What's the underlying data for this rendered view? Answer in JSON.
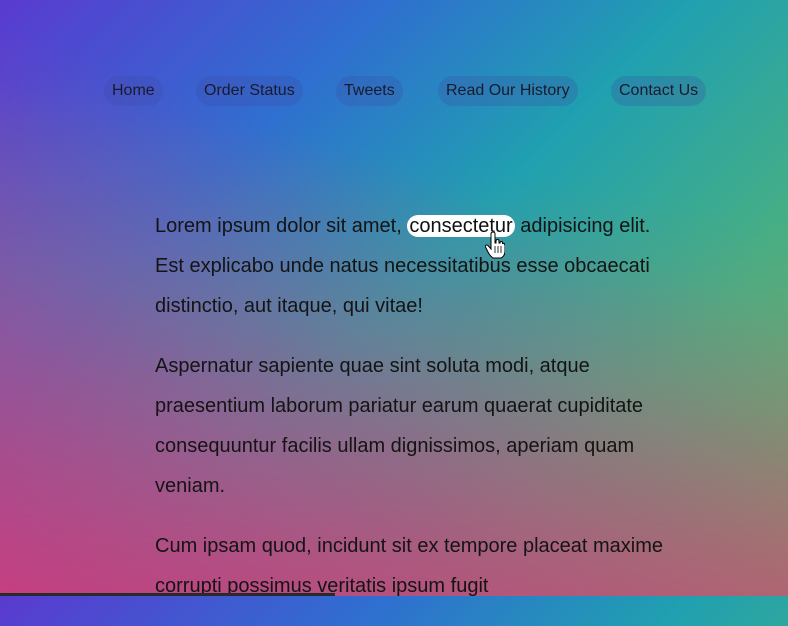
{
  "nav": {
    "items": [
      {
        "label": "Home"
      },
      {
        "label": "Order Status"
      },
      {
        "label": "Tweets"
      },
      {
        "label": "Read Our History"
      },
      {
        "label": "Contact Us"
      }
    ]
  },
  "content": {
    "p1_before": "Lorem ipsum dolor sit amet, ",
    "p1_highlight": "consectetur",
    "p1_after": " adipisicing elit. Est explicabo unde natus necessitatibus esse obcaecati distinctio, aut itaque, qui vitae!",
    "p2": "Aspernatur sapiente quae sint soluta modi, atque praesentium laborum pariatur earum quaerat cupiditate consequuntur facilis ullam dignissimos, aperiam quam veniam.",
    "p3": "Cum ipsam quod, incidunt sit ex tempore placeat maxime corrupti possimus veritatis ipsum fugit"
  },
  "colors": {
    "gradient_top_left": "#5a3ad0",
    "gradient_top_right": "#20a0b0",
    "gradient_bottom_left": "#d0387c",
    "gradient_bottom_right": "#74b060",
    "highlight": "#ffffff"
  },
  "icons": {
    "cursor": "hand-pointer-icon"
  }
}
